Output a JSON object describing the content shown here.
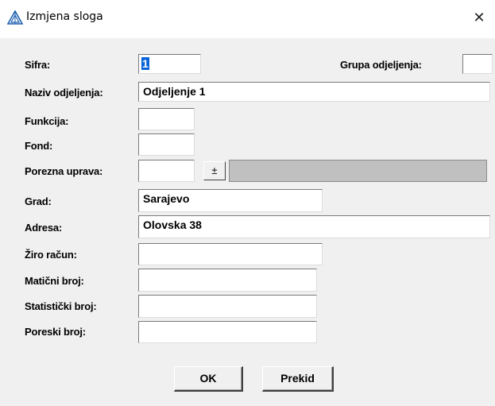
{
  "window": {
    "title": "Izmjena sloga",
    "icon": "app-triangle-icon",
    "close_glyph": "✕"
  },
  "form": {
    "sifra": {
      "label": "Sifra:",
      "value": "1"
    },
    "grupa_odjeljenja": {
      "label": "Grupa odjeljenja:",
      "value": ""
    },
    "naziv_odjeljenja": {
      "label": "Naziv odjeljenja:",
      "value": "Odjeljenje 1"
    },
    "funkcija": {
      "label": "Funkcija:",
      "value": ""
    },
    "fond": {
      "label": "Fond:",
      "value": ""
    },
    "porezna_uprava": {
      "label": "Porezna uprava:",
      "value": "",
      "dropdown_glyph": "±",
      "description": ""
    },
    "grad": {
      "label": "Grad:",
      "value": "Sarajevo"
    },
    "adresa": {
      "label": "Adresa:",
      "value": "Olovska 38"
    },
    "ziro_racun": {
      "label": "Žiro račun:",
      "value": ""
    },
    "maticni_broj": {
      "label": "Matični broj:",
      "value": ""
    },
    "statisticki_broj": {
      "label": "Statistički broj:",
      "value": ""
    },
    "poreski_broj": {
      "label": "Poreski broj:",
      "value": ""
    }
  },
  "buttons": {
    "ok": "OK",
    "cancel": "Prekid"
  }
}
